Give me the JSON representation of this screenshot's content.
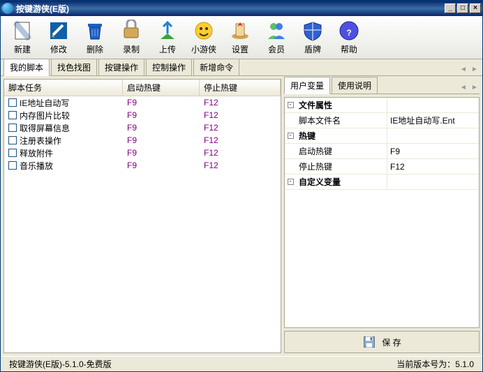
{
  "window": {
    "title": "按键游侠(E版)"
  },
  "toolbar": [
    {
      "label": "新建",
      "name": "new-button",
      "icon": "new"
    },
    {
      "label": "修改",
      "name": "edit-button",
      "icon": "edit"
    },
    {
      "label": "删除",
      "name": "delete-button",
      "icon": "delete"
    },
    {
      "label": "录制",
      "name": "record-button",
      "icon": "record"
    },
    {
      "label": "上传",
      "name": "upload-button",
      "icon": "upload"
    },
    {
      "label": "小游侠",
      "name": "mini-button",
      "icon": "mini"
    },
    {
      "label": "设置",
      "name": "settings-button",
      "icon": "settings"
    },
    {
      "label": "会员",
      "name": "member-button",
      "icon": "member"
    },
    {
      "label": "盾牌",
      "name": "shield-button",
      "icon": "shield"
    },
    {
      "label": "帮助",
      "name": "help-button",
      "icon": "help"
    }
  ],
  "mainTabs": [
    {
      "label": "我的脚本",
      "active": true
    },
    {
      "label": "找色找图",
      "active": false
    },
    {
      "label": "按键操作",
      "active": false
    },
    {
      "label": "控制操作",
      "active": false
    },
    {
      "label": "新增命令",
      "active": false
    }
  ],
  "listHeader": {
    "col1": "脚本任务",
    "col2": "启动热键",
    "col3": "停止热键"
  },
  "scripts": [
    {
      "name": "IE地址自动写",
      "start": "F9",
      "stop": "F12"
    },
    {
      "name": "内存图片比较",
      "start": "F9",
      "stop": "F12"
    },
    {
      "name": "取得屏幕信息",
      "start": "F9",
      "stop": "F12"
    },
    {
      "name": "注册表操作",
      "start": "F9",
      "stop": "F12"
    },
    {
      "name": "释放附件",
      "start": "F9",
      "stop": "F12"
    },
    {
      "name": "音乐播放",
      "start": "F9",
      "stop": "F12"
    }
  ],
  "rightTabs": [
    {
      "label": "用户变量",
      "active": true
    },
    {
      "label": "使用说明",
      "active": false
    }
  ],
  "props": {
    "cat1": "文件属性",
    "fileNameLabel": "脚本文件名",
    "fileNameValue": "IE地址自动写.Ent",
    "cat2": "热键",
    "startLabel": "启动热键",
    "startValue": "F9",
    "stopLabel": "停止热键",
    "stopValue": "F12",
    "cat3": "自定义变量"
  },
  "saveLabel": "保 存",
  "status": {
    "left": "按键游侠(E版)-5.1.0-免费版",
    "right": "当前版本号为：5.1.0"
  }
}
